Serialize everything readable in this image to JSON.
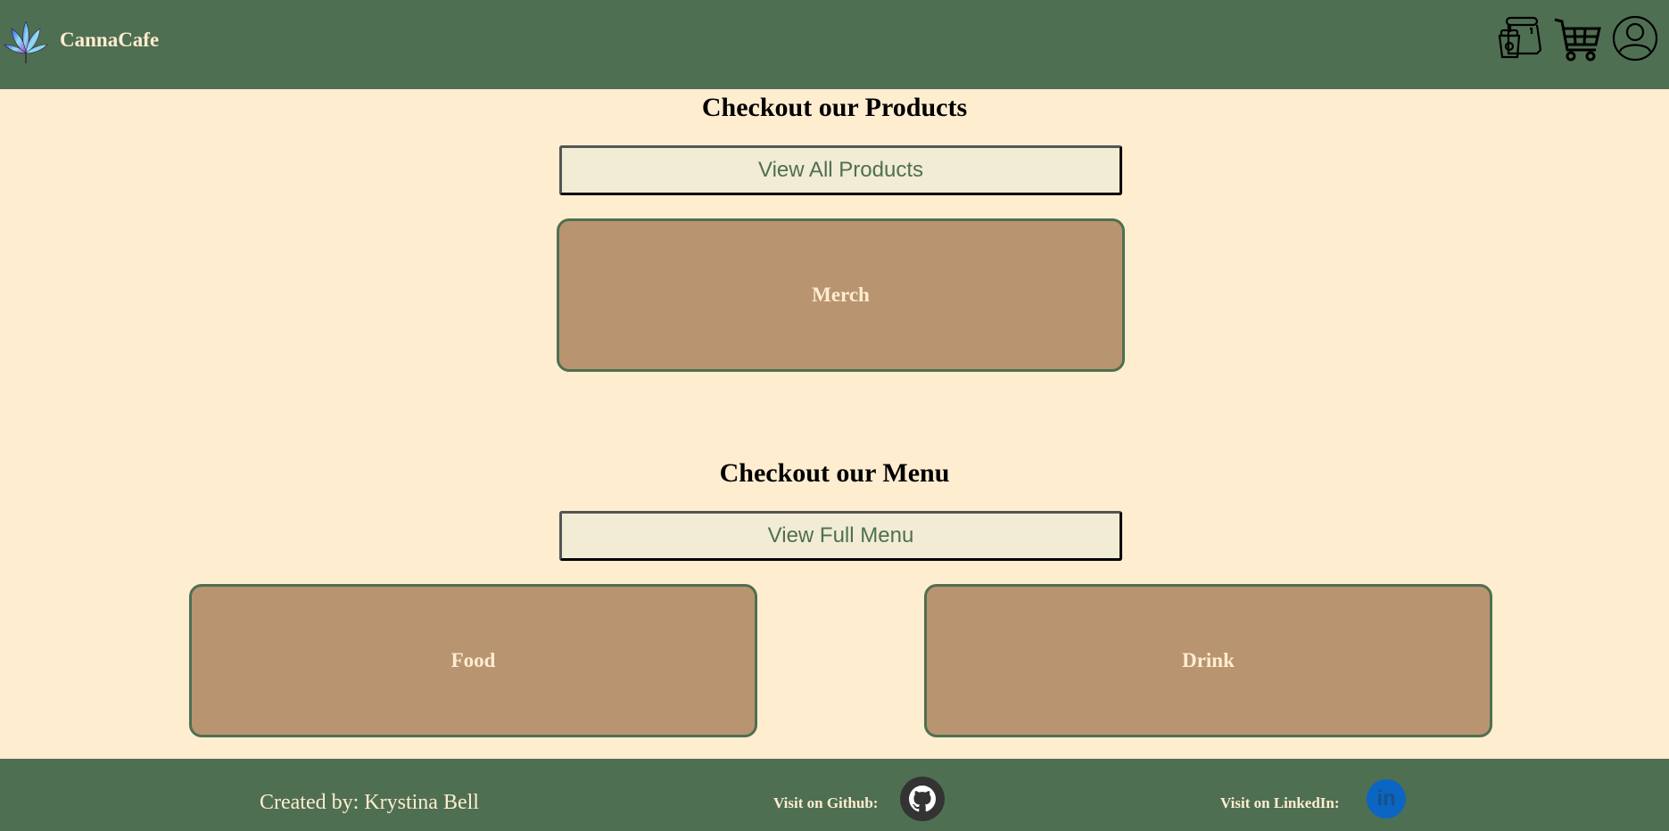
{
  "header": {
    "brand": "CannaCafe",
    "icons": [
      "cannabis-leaf-logo",
      "coffee-bag-icon",
      "cart-icon",
      "user-icon"
    ]
  },
  "products": {
    "heading": "Checkout our Products",
    "button_label": "View All Products",
    "cards": [
      {
        "label": "Merch"
      }
    ]
  },
  "menu": {
    "heading": "Checkout our Menu",
    "button_label": "View Full Menu",
    "cards": [
      {
        "label": "Food"
      },
      {
        "label": "Drink"
      }
    ]
  },
  "footer": {
    "credit": "Created by: Krystina Bell",
    "github_label": "Visit on Github:",
    "linkedin_label": "Visit on LinkedIn:",
    "linkedin_glyph": "in"
  },
  "colors": {
    "header_bg": "#4f6f52",
    "page_bg": "#ffedd0",
    "card_bg": "#b99470",
    "button_bg": "#f1ecd3",
    "linkedin": "#0a66c2",
    "github": "#333333"
  }
}
